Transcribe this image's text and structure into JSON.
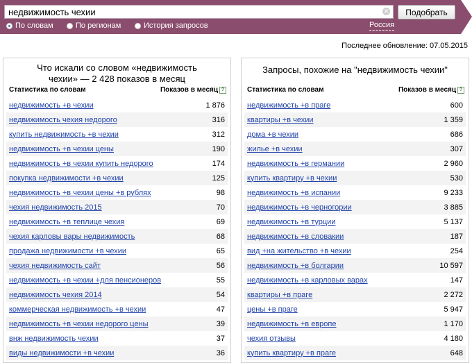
{
  "search": {
    "query": "недвижимость чехии",
    "submit_label": "Подобрать"
  },
  "modes": [
    {
      "label": "По словам",
      "selected": true
    },
    {
      "label": "По регионам",
      "selected": false
    },
    {
      "label": "История запросов",
      "selected": false
    }
  ],
  "region": "Россия",
  "last_update": "Последнее обновление: 07.05.2015",
  "colors": {
    "bar": "#8b4d6d",
    "link": "#2244aa"
  },
  "left": {
    "title": "Что искали со словом «недвижимость чехии» — 2 428 показов в месяц",
    "col_query": "Статистика по словам",
    "col_count": "Показов в месяц",
    "rows": [
      {
        "q": "недвижимость +в чехии",
        "n": "1 876"
      },
      {
        "q": "недвижимость чехия недорого",
        "n": "316"
      },
      {
        "q": "купить недвижимость +в чехии",
        "n": "312"
      },
      {
        "q": "недвижимость +в чехии цены",
        "n": "190"
      },
      {
        "q": "недвижимость +в чехии купить недорого",
        "n": "174"
      },
      {
        "q": "покупка недвижимости +в чехии",
        "n": "125"
      },
      {
        "q": "недвижимость +в чехии цены +в рублях",
        "n": "98"
      },
      {
        "q": "чехия недвижимость 2015",
        "n": "70"
      },
      {
        "q": "недвижимость +в теплице чехия",
        "n": "69"
      },
      {
        "q": "чехия карловы вары недвижимость",
        "n": "68"
      },
      {
        "q": "продажа недвижимости +в чехии",
        "n": "65"
      },
      {
        "q": "чехия недвижимость сайт",
        "n": "56"
      },
      {
        "q": "недвижимость +в чехии +для пенсионеров",
        "n": "55"
      },
      {
        "q": "недвижимость чехия 2014",
        "n": "54"
      },
      {
        "q": "коммерческая недвижимость +в чехии",
        "n": "47"
      },
      {
        "q": "недвижимость +в чехии недорого цены",
        "n": "39"
      },
      {
        "q": "внж недвижимость чехии",
        "n": "37"
      },
      {
        "q": "виды недвижимости +в чехии",
        "n": "36"
      }
    ]
  },
  "right": {
    "title": "Запросы, похожие на \"недвижимость чехии\"",
    "col_query": "Статистика по словам",
    "col_count": "Показов в месяц",
    "rows": [
      {
        "q": "недвижимость +в праге",
        "n": "600"
      },
      {
        "q": "квартиры +в чехии",
        "n": "1 359"
      },
      {
        "q": "дома +в чехии",
        "n": "686"
      },
      {
        "q": "жилье +в чехии",
        "n": "307"
      },
      {
        "q": "недвижимость +в германии",
        "n": "2 960"
      },
      {
        "q": "купить квартиру +в чехии",
        "n": "530"
      },
      {
        "q": "недвижимость +в испании",
        "n": "9 233"
      },
      {
        "q": "недвижимость +в черногории",
        "n": "3 885"
      },
      {
        "q": "недвижимость +в турции",
        "n": "5 137"
      },
      {
        "q": "недвижимость +в словакии",
        "n": "187"
      },
      {
        "q": "вид +на жительство +в чехии",
        "n": "254"
      },
      {
        "q": "недвижимость +в болгарии",
        "n": "10 597"
      },
      {
        "q": "недвижимость +в карловых варах",
        "n": "147"
      },
      {
        "q": "квартиры +в праге",
        "n": "2 272"
      },
      {
        "q": "цены +в праге",
        "n": "5 947"
      },
      {
        "q": "недвижимость +в европе",
        "n": "1 170"
      },
      {
        "q": "чехия отзывы",
        "n": "4 180"
      },
      {
        "q": "купить квартиру +в праге",
        "n": "648"
      }
    ]
  }
}
